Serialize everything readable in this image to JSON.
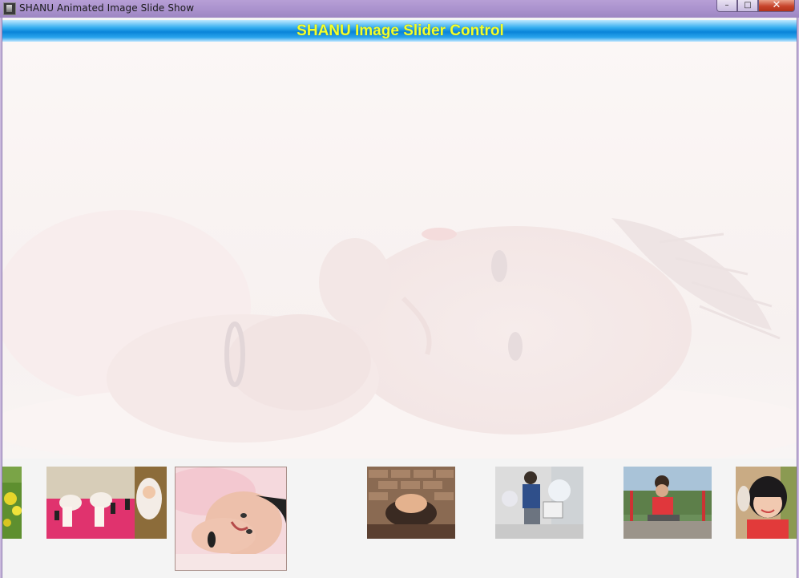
{
  "window": {
    "title": "SHANU Animated Image Slide Show",
    "app_icon": "photo-app-icon",
    "controls": {
      "minimize": "–",
      "maximize": "□",
      "close": "✕"
    }
  },
  "header": {
    "title": "SHANU Image Slider Control",
    "title_color": "#f4ff2a"
  },
  "viewer": {
    "current_image": "baby-lying-smiling-photo",
    "opacity_state": "faded"
  },
  "thumbnails": [
    {
      "name": "yellow-flowers-photo",
      "selected": false
    },
    {
      "name": "twin-babies-photo",
      "selected": false
    },
    {
      "name": "baby-smiling-pink-photo",
      "selected": true
    },
    {
      "name": "baby-in-bowl-photo",
      "selected": false
    },
    {
      "name": "boy-on-bench-photo",
      "selected": false
    },
    {
      "name": "boy-on-swing-photo",
      "selected": false
    },
    {
      "name": "girl-portrait-photo",
      "selected": false
    }
  ]
}
